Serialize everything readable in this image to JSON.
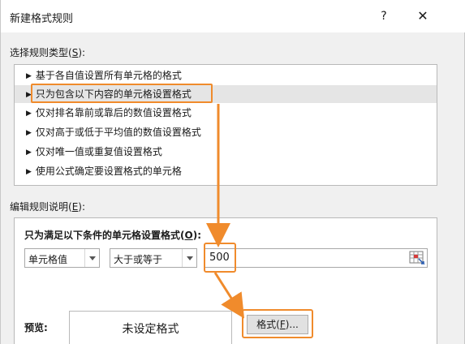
{
  "dialog": {
    "title": "新建格式规则",
    "help_glyph": "?",
    "close_glyph": "✕"
  },
  "rule_type": {
    "label_prefix": "选择规则类型(",
    "label_key": "S",
    "label_suffix": "):",
    "items": [
      "基于各自值设置所有单元格的格式",
      "只为包含以下内容的单元格设置格式",
      "仅对排名靠前或靠后的数值设置格式",
      "仅对高于或低于平均值的数值设置格式",
      "仅对唯一值或重复值设置格式",
      "使用公式确定要设置格式的单元格"
    ],
    "selected_index": 1
  },
  "description": {
    "label_prefix": "编辑规则说明(",
    "label_key": "E",
    "label_suffix": "):",
    "condition_prefix": "只为满足以下条件的单元格设置格式(",
    "condition_key": "O",
    "condition_suffix": "):",
    "field1": "单元格值",
    "field2": "大于或等于",
    "value": "500"
  },
  "preview": {
    "label": "预览:",
    "text": "未设定格式",
    "format_btn_prefix": "格式(",
    "format_btn_key": "F",
    "format_btn_suffix": ")..."
  },
  "colors": {
    "highlight": "#f08b2c",
    "selected_row": "#e5e5e5",
    "dialog_bg": "#f0f0f0"
  }
}
